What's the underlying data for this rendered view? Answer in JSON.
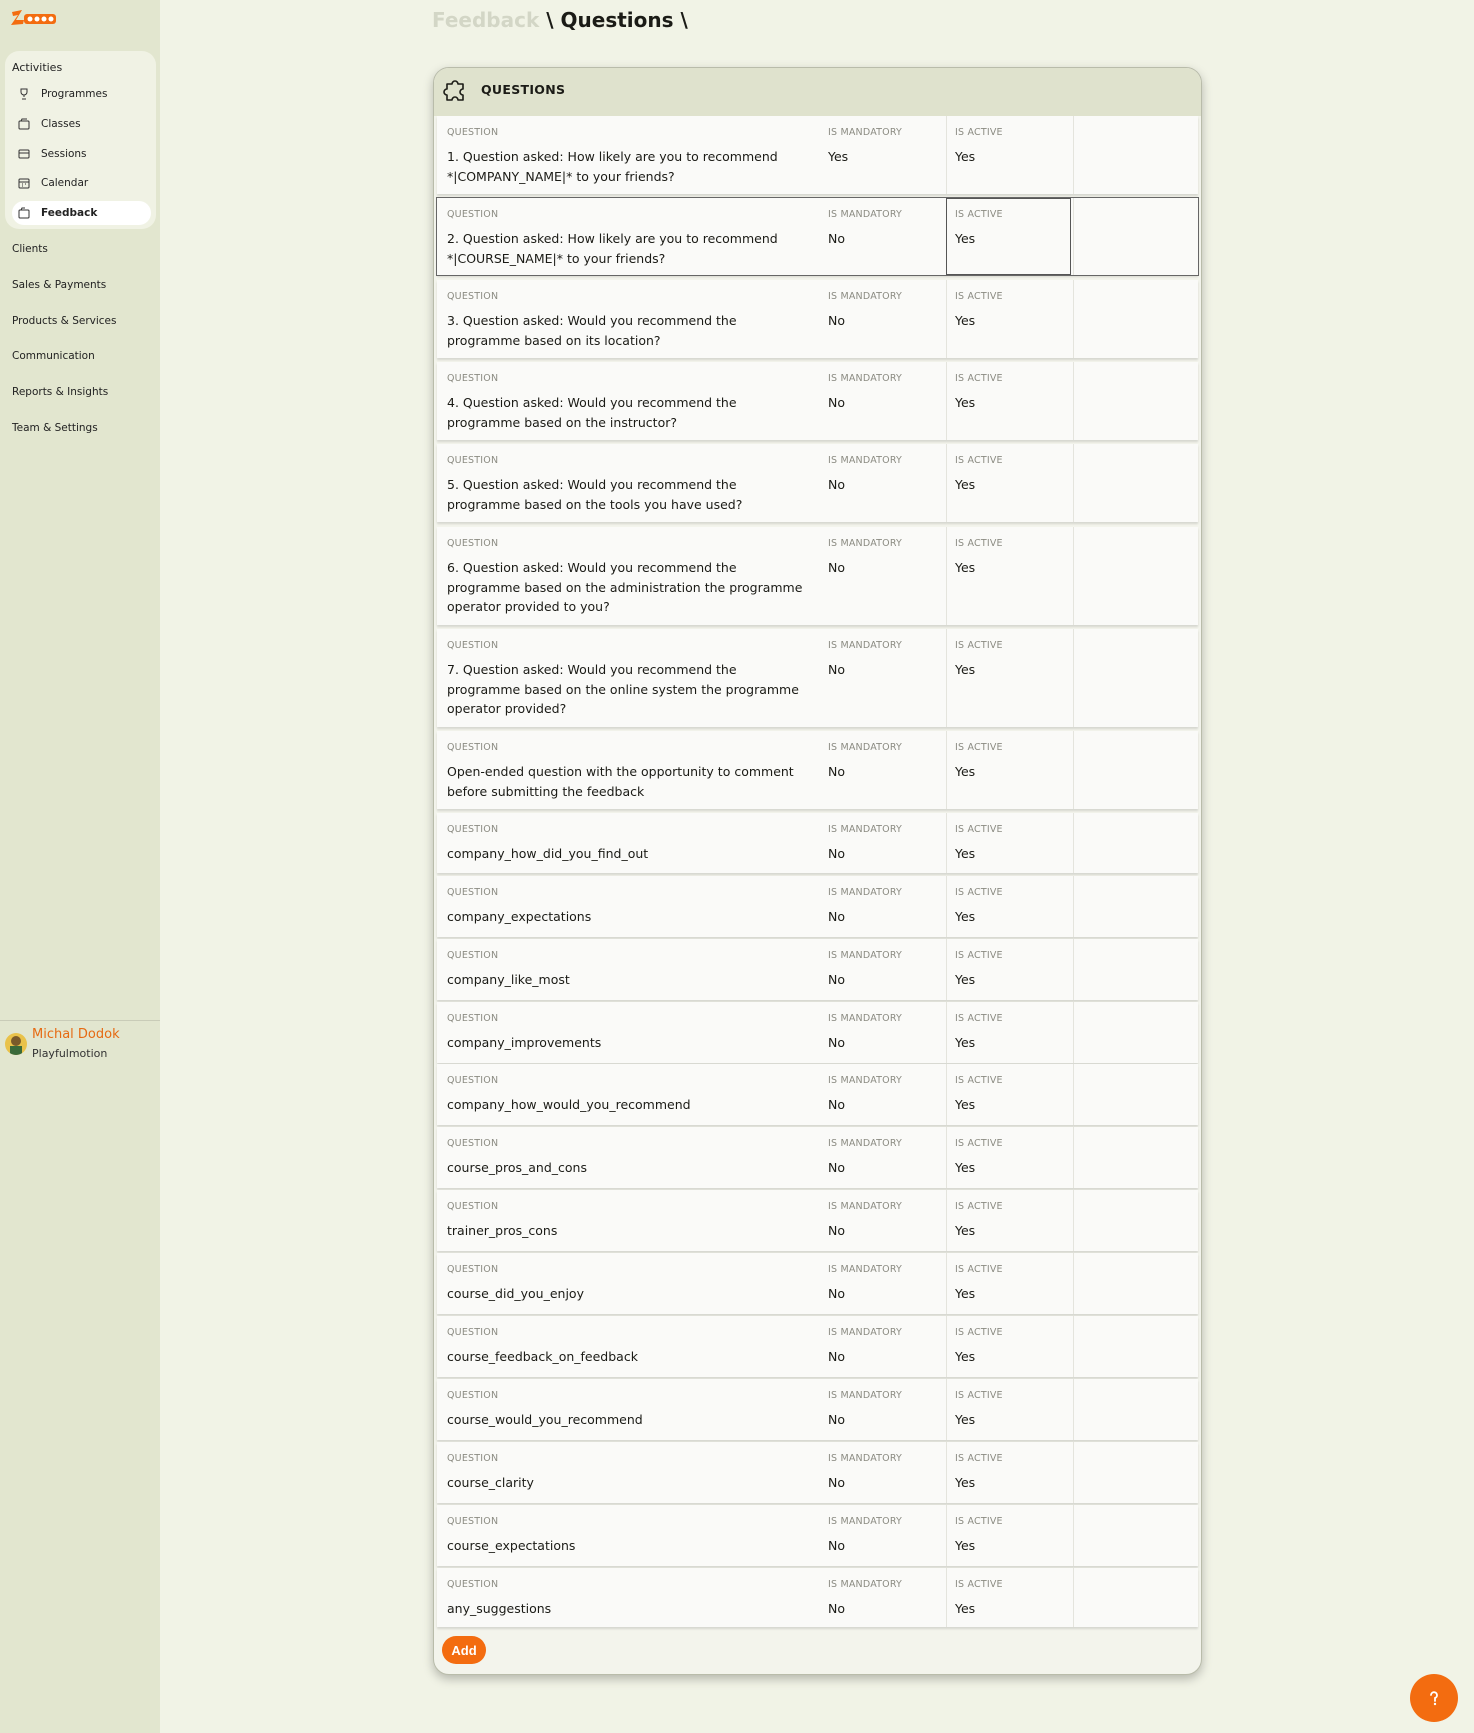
{
  "brand": {
    "logo_text": "Zooza",
    "accent": "#f36c10"
  },
  "sidebar": {
    "group_title": "Activities",
    "items": [
      {
        "label": "Programmes",
        "icon": "trophy-icon",
        "active": false
      },
      {
        "label": "Classes",
        "icon": "folder-icon",
        "active": false
      },
      {
        "label": "Sessions",
        "icon": "ticket-icon",
        "active": false
      },
      {
        "label": "Calendar",
        "icon": "calendar-icon",
        "active": false
      },
      {
        "label": "Feedback",
        "icon": "feedback-icon",
        "active": true
      }
    ],
    "sections": [
      "Clients",
      "Sales & Payments",
      "Products & Services",
      "Communication",
      "Reports & Insights",
      "Team & Settings"
    ]
  },
  "user": {
    "name": "Michal Dodok",
    "org": "Playfulmotion"
  },
  "breadcrumb": {
    "parent": "Feedback",
    "separator": "\\",
    "current": "Questions",
    "trailing": "\\"
  },
  "card": {
    "title": "QUESTIONS",
    "columns": {
      "question": "QUESTION",
      "mandatory": "IS MANDATORY",
      "active": "IS ACTIVE"
    },
    "rows": [
      {
        "question": "1. Question asked: How likely are you to recommend *|COMPANY_NAME|* to your friends?",
        "mandatory": "Yes",
        "active": "Yes"
      },
      {
        "question": "2. Question asked: How likely are you to recommend *|COURSE_NAME|* to your friends?",
        "mandatory": "No",
        "active": "Yes"
      },
      {
        "question": "3. Question asked: Would you recommend the programme based on its location?",
        "mandatory": "No",
        "active": "Yes"
      },
      {
        "question": "4. Question asked: Would you recommend the programme based on the instructor?",
        "mandatory": "No",
        "active": "Yes"
      },
      {
        "question": "5. Question asked: Would you recommend the programme based on the tools you have used?",
        "mandatory": "No",
        "active": "Yes"
      },
      {
        "question": "6. Question asked: Would you recommend the programme based on the administration the programme operator provided to you?",
        "mandatory": "No",
        "active": "Yes"
      },
      {
        "question": "7. Question asked: Would you recommend the programme based on the online system the programme operator provided?",
        "mandatory": "No",
        "active": "Yes"
      },
      {
        "question": "Open-ended question with the opportunity to comment before submitting the feedback",
        "mandatory": "No",
        "active": "Yes"
      },
      {
        "question": "company_how_did_you_find_out",
        "mandatory": "No",
        "active": "Yes"
      },
      {
        "question": "company_expectations",
        "mandatory": "No",
        "active": "Yes"
      },
      {
        "question": "company_like_most",
        "mandatory": "No",
        "active": "Yes"
      },
      {
        "question": "company_improvements",
        "mandatory": "No",
        "active": "Yes"
      },
      {
        "question": "company_how_would_you_recommend",
        "mandatory": "No",
        "active": "Yes"
      },
      {
        "question": "course_pros_and_cons",
        "mandatory": "No",
        "active": "Yes"
      },
      {
        "question": "trainer_pros_cons",
        "mandatory": "No",
        "active": "Yes"
      },
      {
        "question": "course_did_you_enjoy",
        "mandatory": "No",
        "active": "Yes"
      },
      {
        "question": "course_feedback_on_feedback",
        "mandatory": "No",
        "active": "Yes"
      },
      {
        "question": "course_would_you_recommend",
        "mandatory": "No",
        "active": "Yes"
      },
      {
        "question": "course_clarity",
        "mandatory": "No",
        "active": "Yes"
      },
      {
        "question": "course_expectations",
        "mandatory": "No",
        "active": "Yes"
      },
      {
        "question": "any_suggestions",
        "mandatory": "No",
        "active": "Yes"
      }
    ],
    "add_label": "Add"
  },
  "help": {
    "icon": "help-icon"
  }
}
